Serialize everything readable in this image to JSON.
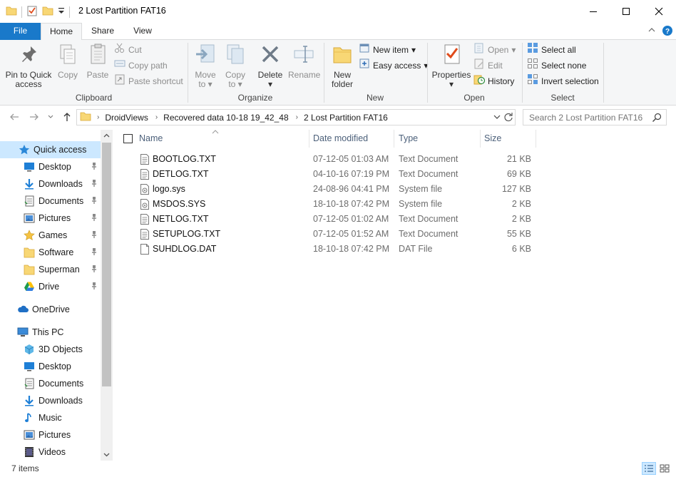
{
  "window": {
    "title": "2 Lost Partition FAT16"
  },
  "ribbon": {
    "tabs": {
      "file": "File",
      "home": "Home",
      "share": "Share",
      "view": "View"
    },
    "clipboard": {
      "label": "Clipboard",
      "pin_line1": "Pin to Quick",
      "pin_line2": "access",
      "copy": "Copy",
      "paste": "Paste",
      "cut": "Cut",
      "copy_path": "Copy path",
      "paste_shortcut": "Paste shortcut"
    },
    "organize": {
      "label": "Organize",
      "move_line1": "Move",
      "move_line2": "to",
      "copy_line1": "Copy",
      "copy_line2": "to",
      "delete": "Delete",
      "rename": "Rename"
    },
    "new": {
      "label": "New",
      "new_folder_line1": "New",
      "new_folder_line2": "folder",
      "new_item": "New item",
      "easy_access": "Easy access"
    },
    "open": {
      "label": "Open",
      "properties": "Properties",
      "open": "Open",
      "edit": "Edit",
      "history": "History"
    },
    "select": {
      "label": "Select",
      "select_all": "Select all",
      "select_none": "Select none",
      "invert_selection": "Invert selection"
    }
  },
  "address": {
    "crumbs": [
      "DroidViews",
      "Recovered data 10-18 19_42_48",
      "2 Lost Partition FAT16"
    ],
    "search_placeholder": "Search 2 Lost Partition FAT16"
  },
  "nav": {
    "quick_access": "Quick access",
    "quick_items": [
      {
        "label": "Desktop",
        "icon": "desktop-icon"
      },
      {
        "label": "Downloads",
        "icon": "downloads-icon"
      },
      {
        "label": "Documents",
        "icon": "documents-icon"
      },
      {
        "label": "Pictures",
        "icon": "pictures-icon"
      },
      {
        "label": "Games",
        "icon": "star-icon"
      },
      {
        "label": "Software",
        "icon": "folder-icon"
      },
      {
        "label": "Superman",
        "icon": "folder-icon"
      },
      {
        "label": "Drive",
        "icon": "drive-icon"
      }
    ],
    "onedrive": "OneDrive",
    "this_pc": "This PC",
    "pc_items": [
      {
        "label": "3D Objects",
        "icon": "3d-objects-icon"
      },
      {
        "label": "Desktop",
        "icon": "desktop-icon"
      },
      {
        "label": "Documents",
        "icon": "documents-icon"
      },
      {
        "label": "Downloads",
        "icon": "downloads-icon"
      },
      {
        "label": "Music",
        "icon": "music-icon"
      },
      {
        "label": "Pictures",
        "icon": "pictures-icon"
      },
      {
        "label": "Videos",
        "icon": "videos-icon"
      }
    ]
  },
  "columns": {
    "name": "Name",
    "date": "Date modified",
    "type": "Type",
    "size": "Size"
  },
  "files": [
    {
      "name": "BOOTLOG.TXT",
      "date": "07-12-05 01:03 AM",
      "type": "Text Document",
      "size": "21 KB",
      "icon": "text-file-icon"
    },
    {
      "name": "DETLOG.TXT",
      "date": "04-10-16 07:19 PM",
      "type": "Text Document",
      "size": "69 KB",
      "icon": "text-file-icon"
    },
    {
      "name": "logo.sys",
      "date": "24-08-96 04:41 PM",
      "type": "System file",
      "size": "127 KB",
      "icon": "system-file-icon"
    },
    {
      "name": "MSDOS.SYS",
      "date": "18-10-18 07:42 PM",
      "type": "System file",
      "size": "2 KB",
      "icon": "system-file-icon"
    },
    {
      "name": "NETLOG.TXT",
      "date": "07-12-05 01:02 AM",
      "type": "Text Document",
      "size": "2 KB",
      "icon": "text-file-icon"
    },
    {
      "name": "SETUPLOG.TXT",
      "date": "07-12-05 01:52 AM",
      "type": "Text Document",
      "size": "55 KB",
      "icon": "text-file-icon"
    },
    {
      "name": "SUHDLOG.DAT",
      "date": "18-10-18 07:42 PM",
      "type": "DAT File",
      "size": "6 KB",
      "icon": "blank-file-icon"
    }
  ],
  "status": {
    "item_count": "7 items"
  },
  "colors": {
    "accent": "#1979ca",
    "selection": "#cce8ff",
    "ribbon_bg": "#f5f6f7"
  }
}
